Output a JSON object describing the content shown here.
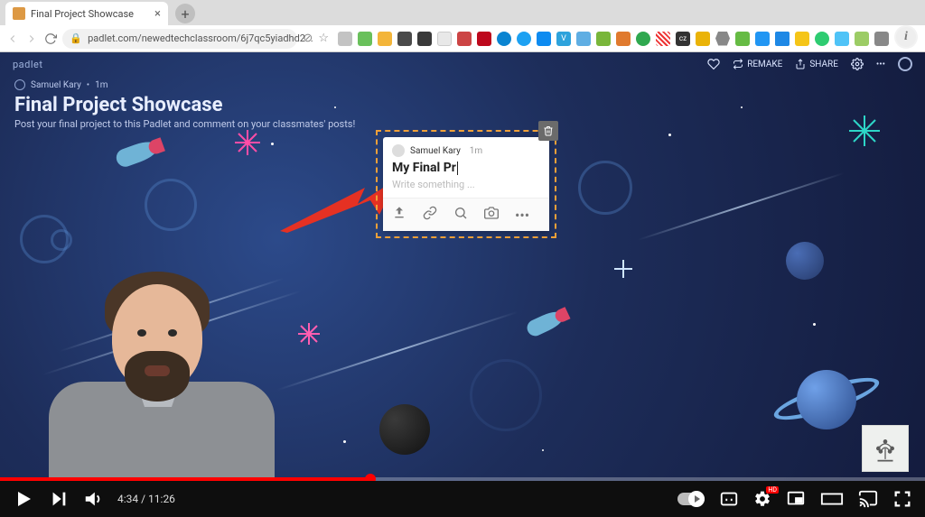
{
  "browser": {
    "tab_title": "Final Project Showcase",
    "url": "padlet.com/newedtechclassroom/6j7qc5yiadhd2..."
  },
  "padlet": {
    "brand": "padlet",
    "author": "Samuel Kary",
    "age": "1m",
    "title": "Final Project Showcase",
    "subtitle": "Post your final project to this Padlet and comment on your classmates' posts!",
    "actions": {
      "remake": "REMAKE",
      "share": "SHARE"
    }
  },
  "post": {
    "author": "Samuel Kary",
    "age": "1m",
    "title_value": "My Final Pr",
    "body_placeholder": "Write something ...",
    "tool_more": "•••"
  },
  "video": {
    "current_time": "4:34",
    "duration": "11:26",
    "progress_pct": 40,
    "hd_label": "HD"
  }
}
